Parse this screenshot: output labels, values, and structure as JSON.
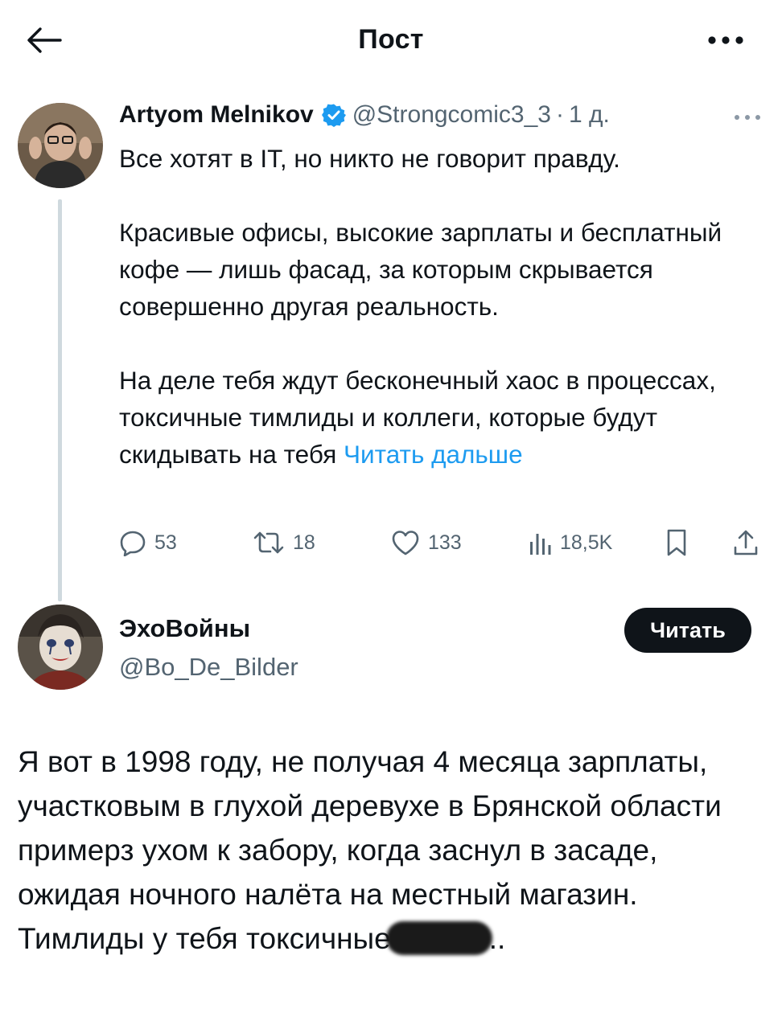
{
  "header": {
    "title": "Пост",
    "back_icon": "arrow-left-icon",
    "more_icon": "more-horizontal-icon"
  },
  "post": {
    "author_name": "Artyom Melnikov",
    "verified": true,
    "handle": "@Strongcomic3_3",
    "separator": "·",
    "time": "1 д.",
    "paragraphs": [
      "Все хотят в IT, но никто не говорит правду.",
      "Красивые офисы, высокие зарплаты и бесплатный кофе — лишь фасад, за которым скрывается совершенно другая реальность.",
      "На деле тебя ждут бесконечный хаос в процессах, токсичные тимлиды и коллеги, которые будут скидывать на тебя"
    ],
    "read_more": "Читать дальше",
    "actions": {
      "replies": "53",
      "reposts": "18",
      "likes": "133",
      "views": "18,5K"
    }
  },
  "reply": {
    "author_name": "ЭхоВойны",
    "handle": "@Bo_De_Bilder",
    "follow_label": "Читать",
    "text_before_redaction": "Я вот в 1998 году, не получая 4 месяца зарплаты, участковым в глухой деревухе в Брянской области примерз ухом к забору, когда заснул в засаде, ожидая ночного налёта на местный магазин. Тимлиды у тебя токсичные",
    "text_after_redaction": ".."
  },
  "colors": {
    "text": "#0f1419",
    "secondary": "#536471",
    "accent": "#1d9bf0",
    "thread_line": "#cfd9de",
    "button_bg": "#0f1419"
  }
}
